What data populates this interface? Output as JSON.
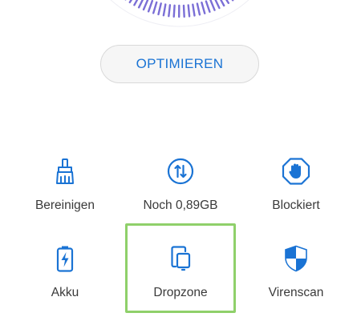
{
  "optimize": {
    "label": "OPTIMIEREN"
  },
  "tiles": [
    {
      "label": "Bereinigen",
      "icon": "broom-icon"
    },
    {
      "label": "Noch 0,89GB",
      "icon": "data-transfer-icon"
    },
    {
      "label": "Blockiert",
      "icon": "block-hand-icon"
    },
    {
      "label": "Akku",
      "icon": "battery-icon"
    },
    {
      "label": "Dropzone",
      "icon": "dropzone-icon"
    },
    {
      "label": "Virenscan",
      "icon": "shield-icon"
    }
  ],
  "colors": {
    "accent": "#1a73d4",
    "dial": "#7b6fd6",
    "highlight": "#8fd06a"
  }
}
